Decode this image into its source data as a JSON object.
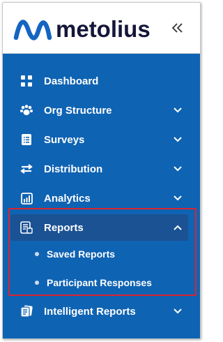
{
  "brand": {
    "name": "metolius",
    "logo_color": "#1565c0",
    "text_color": "#16163a"
  },
  "sidebar": {
    "background": "#0f63b3",
    "items": [
      {
        "label": "Dashboard",
        "icon": "grid-icon",
        "expandable": false
      },
      {
        "label": "Org Structure",
        "icon": "paw-icon",
        "expandable": true,
        "expanded": false
      },
      {
        "label": "Surveys",
        "icon": "list-doc-icon",
        "expandable": true,
        "expanded": false
      },
      {
        "label": "Distribution",
        "icon": "swap-arrows-icon",
        "expandable": true,
        "expanded": false
      },
      {
        "label": "Analytics",
        "icon": "bar-chart-icon",
        "expandable": true,
        "expanded": false
      },
      {
        "label": "Reports",
        "icon": "report-doc-icon",
        "expandable": true,
        "expanded": true
      },
      {
        "label": "Intelligent Reports",
        "icon": "stacked-docs-icon",
        "expandable": true,
        "expanded": false
      }
    ],
    "reports_children": [
      {
        "label": "Saved Reports"
      },
      {
        "label": "Participant Responses"
      }
    ]
  },
  "highlight_color": "#d9252f"
}
